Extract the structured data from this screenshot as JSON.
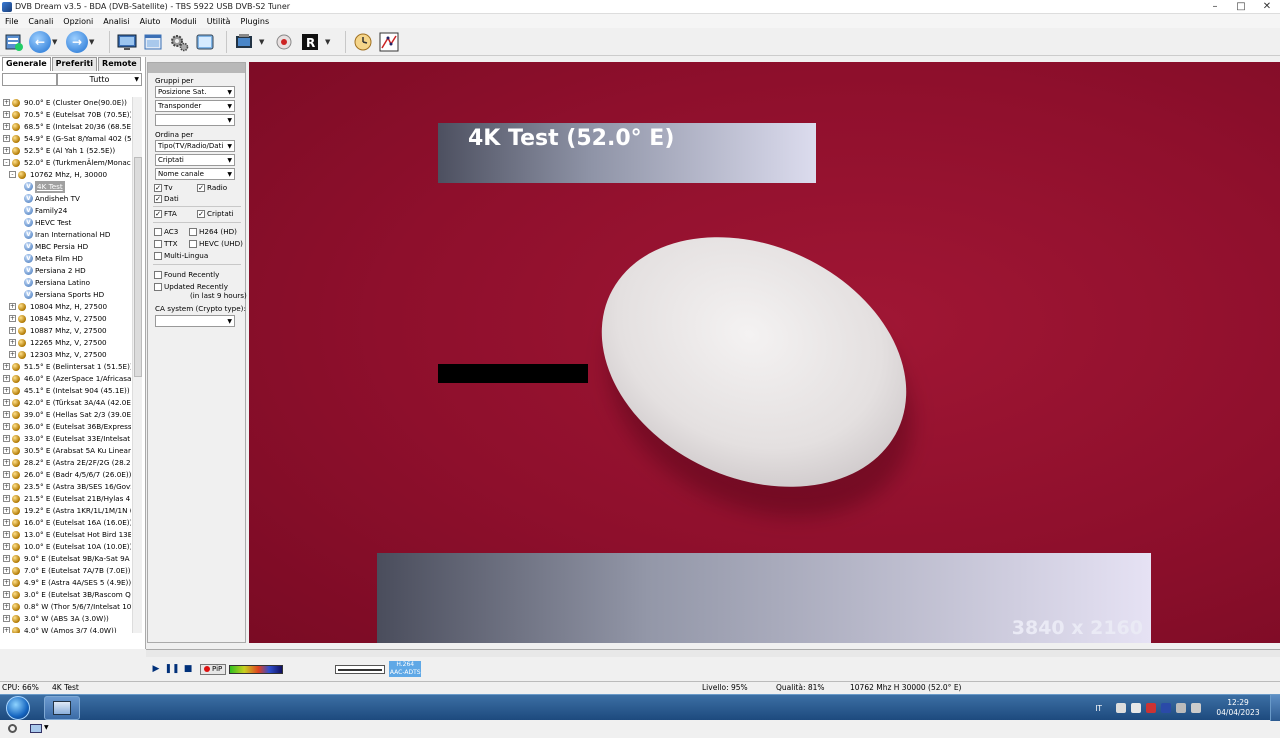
{
  "window": {
    "title": "DVB Dream v3.5  - BDA (DVB-Satellite)  - TBS 5922 USB DVB-S2 Tuner"
  },
  "menu": [
    "File",
    "Canali",
    "Opzioni",
    "Analisi",
    "Aiuto",
    "Moduli",
    "Utilità",
    "Plugins"
  ],
  "toolbar": {
    "icons": [
      "channel-list-icon",
      "back-icon",
      "forward-icon",
      "monitor-icon",
      "window-icon",
      "settings-gears-icon",
      "scan-icon",
      "epg-icon",
      "record-icon",
      "r-icon",
      "clock-icon",
      "network-icon"
    ]
  },
  "left_panel": {
    "tabs": [
      "Generale",
      "Preferiti",
      "Remote"
    ],
    "filter_value": "Tutto",
    "tree": [
      {
        "label": "90.0° E (Cluster One(90.0E))",
        "level": 0,
        "kind": "sat",
        "expand": "+"
      },
      {
        "label": "70.5° E (Eutelsat 70B (70.5E))",
        "level": 0,
        "kind": "sat",
        "expand": "+"
      },
      {
        "label": "68.5° E (Intelsat 20/36 (68.5E))",
        "level": 0,
        "kind": "sat",
        "expand": "+"
      },
      {
        "label": "54.9° E (G-Sat 8/Yamal 402 (54.9",
        "level": 0,
        "kind": "sat",
        "expand": "+"
      },
      {
        "label": "52.5° E (Al Yah 1 (52.5E))",
        "level": 0,
        "kind": "sat",
        "expand": "+"
      },
      {
        "label": "52.0° E (TurkmenÄlem/MonacoSa",
        "level": 0,
        "kind": "sat",
        "expand": "-"
      },
      {
        "label": "10762 Mhz, H, 30000",
        "level": 1,
        "kind": "tp",
        "expand": "-"
      },
      {
        "label": "4K Test",
        "level": 2,
        "kind": "ch",
        "expand": "",
        "selected": true
      },
      {
        "label": "Andisheh TV",
        "level": 2,
        "kind": "ch",
        "expand": ""
      },
      {
        "label": "Family24",
        "level": 2,
        "kind": "ch",
        "expand": ""
      },
      {
        "label": "HEVC Test",
        "level": 2,
        "kind": "ch",
        "expand": ""
      },
      {
        "label": "Iran International HD",
        "level": 2,
        "kind": "ch",
        "expand": ""
      },
      {
        "label": "MBC Persia HD",
        "level": 2,
        "kind": "ch",
        "expand": ""
      },
      {
        "label": "Meta Film HD",
        "level": 2,
        "kind": "ch",
        "expand": ""
      },
      {
        "label": "Persiana 2 HD",
        "level": 2,
        "kind": "ch",
        "expand": ""
      },
      {
        "label": "Persiana Latino",
        "level": 2,
        "kind": "ch",
        "expand": ""
      },
      {
        "label": "Persiana Sports HD",
        "level": 2,
        "kind": "ch",
        "expand": ""
      },
      {
        "label": "10804 Mhz, H, 27500",
        "level": 1,
        "kind": "tp",
        "expand": "+"
      },
      {
        "label": "10845 Mhz, V, 27500",
        "level": 1,
        "kind": "tp",
        "expand": "+"
      },
      {
        "label": "10887 Mhz, V, 27500",
        "level": 1,
        "kind": "tp",
        "expand": "+"
      },
      {
        "label": "12265 Mhz, V, 27500",
        "level": 1,
        "kind": "tp",
        "expand": "+"
      },
      {
        "label": "12303 Mhz, V, 27500",
        "level": 1,
        "kind": "tp",
        "expand": "+"
      },
      {
        "label": "51.5° E (Belintersat 1 (51.5E))",
        "level": 0,
        "kind": "sat",
        "expand": "+"
      },
      {
        "label": "46.0° E (AzerSpace 1/Africasat",
        "level": 0,
        "kind": "sat",
        "expand": "+"
      },
      {
        "label": "45.1° E (Intelsat 904 (45.1E))",
        "level": 0,
        "kind": "sat",
        "expand": "+"
      },
      {
        "label": "42.0° E (Türksat 3A/4A (42.0E))",
        "level": 0,
        "kind": "sat",
        "expand": "+"
      },
      {
        "label": "39.0° E (Hellas Sat 2/3 (39.0E))",
        "level": 0,
        "kind": "sat",
        "expand": "+"
      },
      {
        "label": "36.0° E (Eutelsat 36B/Express AI",
        "level": 0,
        "kind": "sat",
        "expand": "+"
      },
      {
        "label": "33.0° E (Eutelsat 33E/Intelsat 28 (",
        "level": 0,
        "kind": "sat",
        "expand": "+"
      },
      {
        "label": "30.5° E (Arabsat 5A Ku Linear)",
        "level": 0,
        "kind": "sat",
        "expand": "+"
      },
      {
        "label": "28.2° E (Astra 2E/2F/2G (28.2E))",
        "level": 0,
        "kind": "sat",
        "expand": "+"
      },
      {
        "label": "26.0° E (Badr 4/5/6/7 (26.0E))",
        "level": 0,
        "kind": "sat",
        "expand": "+"
      },
      {
        "label": "23.5° E (Astra 3B/SES 16/GovSa",
        "level": 0,
        "kind": "sat",
        "expand": "+"
      },
      {
        "label": "21.5° E (Eutelsat 21B/Hylas 4 (21",
        "level": 0,
        "kind": "sat",
        "expand": "+"
      },
      {
        "label": "19.2° E (Astra 1KR/1L/1M/1N (19",
        "level": 0,
        "kind": "sat",
        "expand": "+"
      },
      {
        "label": "16.0° E (Eutelsat 16A (16.0E))",
        "level": 0,
        "kind": "sat",
        "expand": "+"
      },
      {
        "label": "13.0° E (Eutelsat Hot Bird 13B/13",
        "level": 0,
        "kind": "sat",
        "expand": "+"
      },
      {
        "label": "10.0° E (Eutelsat 10A (10.0E))",
        "level": 0,
        "kind": "sat",
        "expand": "+"
      },
      {
        "label": "9.0° E (Eutelsat 9B/Ka-Sat 9A (9.",
        "level": 0,
        "kind": "sat",
        "expand": "+"
      },
      {
        "label": "7.0° E (Eutelsat 7A/7B (7.0E))",
        "level": 0,
        "kind": "sat",
        "expand": "+"
      },
      {
        "label": "4.9° E (Astra 4A/SES 5 (4.9E))",
        "level": 0,
        "kind": "sat",
        "expand": "+"
      },
      {
        "label": "3.0° E (Eutelsat 3B/Rascom QAF",
        "level": 0,
        "kind": "sat",
        "expand": "+"
      },
      {
        "label": "0.8° W (Thor 5/6/7/Intelsat 10-02",
        "level": 0,
        "kind": "sat",
        "expand": "+"
      },
      {
        "label": "3.0° W (ABS 3A (3.0W))",
        "level": 0,
        "kind": "sat",
        "expand": "+"
      },
      {
        "label": "4.0° W (Amos 3/7 (4.0W))",
        "level": 0,
        "kind": "sat",
        "expand": "+"
      }
    ]
  },
  "filter_panel": {
    "group_by_label": "Gruppi per",
    "group_by_1": "Posizione Sat.",
    "group_by_2": "Transponder",
    "group_by_3": "",
    "order_by_label": "Ordina per",
    "order_by_1": "Tipo(TV/Radio/Dati",
    "order_by_2": "Criptati",
    "order_by_3": "Nome canale",
    "cb_tv": "Tv",
    "cb_radio": "Radio",
    "cb_dati": "Dati",
    "cb_fta": "FTA",
    "cb_criptati": "Criptati",
    "cb_ac3": "AC3",
    "cb_h264": "H264 (HD)",
    "cb_ttx": "TTX",
    "cb_hevc": "HEVC (UHD)",
    "cb_multilingua": "Multi-Lingua",
    "cb_found_recently": "Found Recently",
    "cb_updated_recently": "Updated Recently",
    "updated_note": "(in last 9 hours)",
    "ca_label": "CA system (Crypto type):",
    "ca_value": ""
  },
  "video": {
    "overlay_title": "4K Test (52.0° E)",
    "resolution": "3840 x 2160"
  },
  "playback": {
    "pip_label": "PiP",
    "codec_video": "H.264",
    "codec_audio": "AAC-ADTS"
  },
  "status": {
    "cpu": "CPU: 66%",
    "channel": "4K Test",
    "level": "Livello: 95%",
    "quality": "Qualità: 81%",
    "tuning": "10762 Mhz  H  30000  (52.0° E)"
  },
  "taskbar": {
    "lang": "IT",
    "time": "12:29",
    "date": "04/04/2023"
  }
}
